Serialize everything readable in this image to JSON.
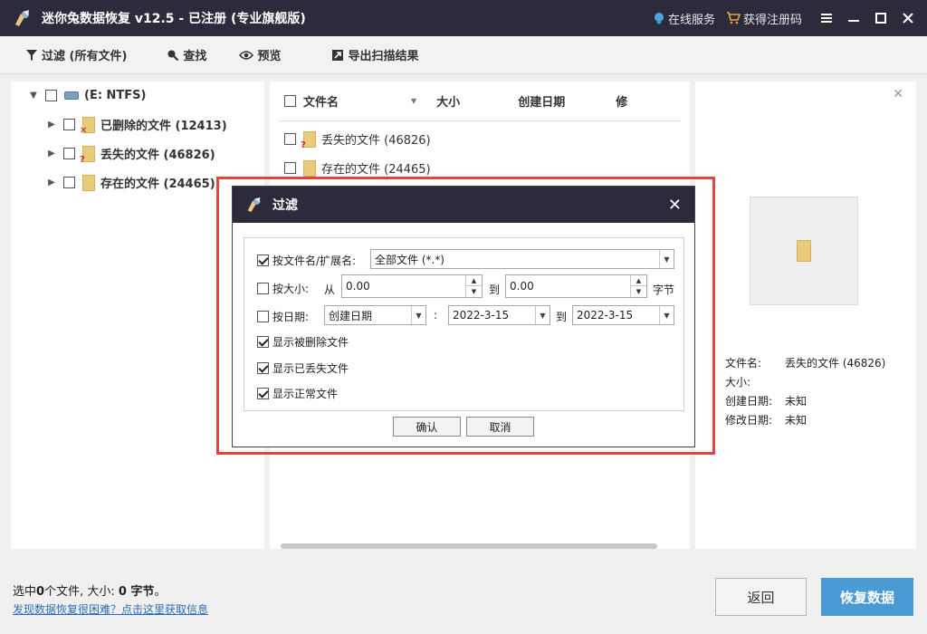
{
  "app": {
    "title": "迷你兔数据恢复 v12.5 - 已注册 (专业旗舰版)",
    "online_service": "在线服务",
    "get_code": "获得注册码"
  },
  "toolbar": {
    "filter": "过滤 (所有文件)",
    "find": "查找",
    "preview": "预览",
    "export": "导出扫描结果"
  },
  "tree": {
    "root": "(E: NTFS)",
    "items": [
      {
        "label": "已删除的文件 (12413)",
        "mark": "x"
      },
      {
        "label": "丢失的文件 (46826)",
        "mark": "?"
      },
      {
        "label": "存在的文件 (24465)",
        "mark": ""
      }
    ]
  },
  "list": {
    "headers": [
      "文件名",
      "大小",
      "创建日期",
      "修"
    ],
    "rows": [
      {
        "name": "丢失的文件 (46826)"
      },
      {
        "name": "存在的文件 (24465)"
      }
    ]
  },
  "preview": {
    "rows": [
      {
        "key": "文件名:",
        "value": "丢失的文件 (46826)"
      },
      {
        "key": "大小:",
        "value": ""
      },
      {
        "key": "创建日期:",
        "value": "未知"
      },
      {
        "key": "修改日期:",
        "value": "未知"
      }
    ]
  },
  "dialog": {
    "title": "过滤",
    "by_name_label": "按文件名/扩展名:",
    "by_name_value": "全部文件 (*.*)",
    "by_size_label": "按大小:",
    "from": "从",
    "size_from": "0.00",
    "to": "到",
    "size_to": "0.00",
    "unit": "字节",
    "by_date_label": "按日期:",
    "date_type": "创建日期",
    "colon": ":",
    "date_from": "2022-3-15",
    "date_to": "2022-3-15",
    "show_deleted": "显示被删除文件",
    "show_lost": "显示已丢失文件",
    "show_normal": "显示正常文件",
    "ok": "确认",
    "cancel": "取消"
  },
  "bottom": {
    "status_prefix": "选中",
    "status_count": "0",
    "status_mid": "个文件, 大小:",
    "status_size": "0 字节",
    "status_suffix": "。",
    "help": "发现数据恢复很困难？点击这里获取信息",
    "back": "返回",
    "recover": "恢复数据"
  },
  "colors": {
    "titlebar": "#2b2b3b",
    "accent": "#4a9bd4",
    "highlight": "#e8423c"
  }
}
